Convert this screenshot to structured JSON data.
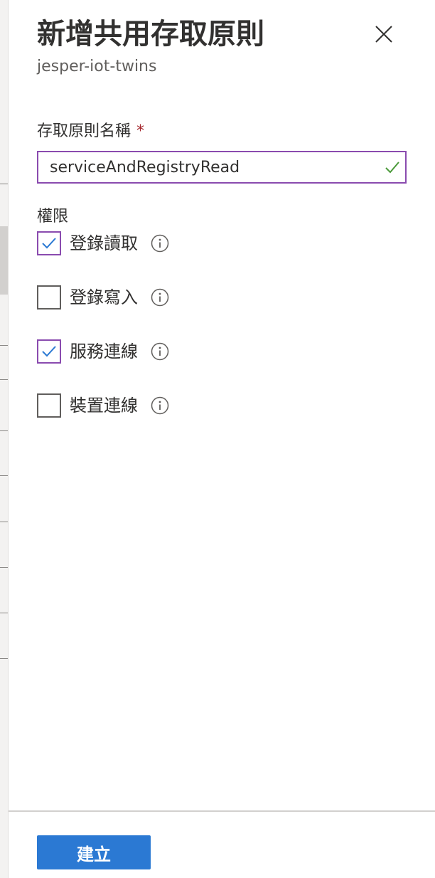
{
  "panel": {
    "title": "新增共用存取原則",
    "subtitle": "jesper-iot-twins"
  },
  "policy_name": {
    "label": "存取原則名稱",
    "required_marker": "*",
    "value": "serviceAndRegistryRead",
    "valid": true
  },
  "permissions": {
    "label": "權限",
    "items": [
      {
        "label": "登錄讀取",
        "checked": true
      },
      {
        "label": "登錄寫入",
        "checked": false
      },
      {
        "label": "服務連線",
        "checked": true
      },
      {
        "label": "裝置連線",
        "checked": false
      }
    ]
  },
  "footer": {
    "create_label": "建立"
  },
  "colors": {
    "focus_border": "#8a4baf",
    "valid_check": "#4b9a3a",
    "primary_button": "#2b79d3",
    "required": "#a4262c"
  },
  "icons": {
    "close": "close-icon",
    "valid": "checkmark-icon",
    "info": "info-icon"
  }
}
